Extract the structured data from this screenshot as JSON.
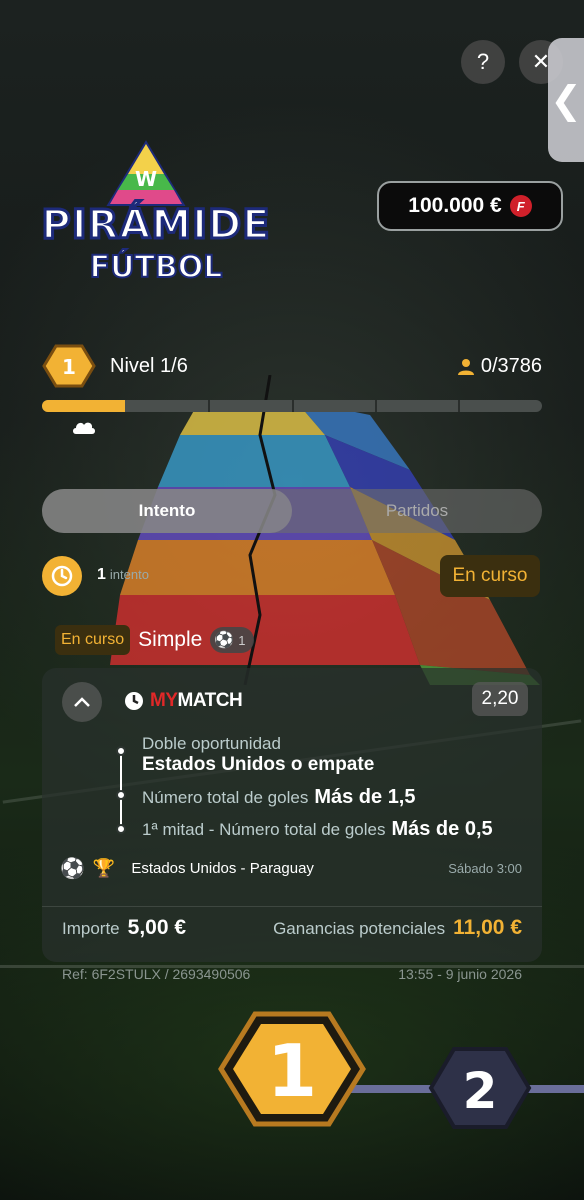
{
  "header": {
    "help_label": "?",
    "close_label": "✕",
    "side_tab_glyph": "❮",
    "logo_badge_letter": "W",
    "logo_line1": "PIRÁMIDE",
    "logo_line2": "FÚTBOL",
    "balance": "100.000 €",
    "balance_coin_letter": "F"
  },
  "level": {
    "badge_number": "1",
    "label": "Nivel 1/6",
    "players": "0/3786",
    "progress": 0.165
  },
  "tabs": [
    {
      "label": "Intento",
      "active": true
    },
    {
      "label": "Partidos",
      "active": false
    }
  ],
  "attempt": {
    "count": "1",
    "word": "intento",
    "status": "En curso"
  },
  "bet": {
    "status_pill": "En curso",
    "type": "Simple",
    "ball_count": "1",
    "brand_my": "MY",
    "brand_match": "MATCH",
    "odds": "2,20",
    "selections": [
      {
        "market": "Doble oportunidad",
        "value": "Estados Unidos o empate"
      },
      {
        "market": "Número total de goles",
        "value": "Más de 1,5"
      },
      {
        "market": "1ª mitad - Número total de goles",
        "value": "Más de 0,5"
      }
    ],
    "teams": "Estados Unidos - Paraguay",
    "date": "Sábado 3:00",
    "stake_label": "Importe",
    "stake_value": "5,00 €",
    "gain_label": "Ganancias potenciales",
    "gain_value": "11,00 €",
    "ref": "Ref: 6F2STULX / 2693490506",
    "timestamp": "13:55 - 9 junio 2026"
  },
  "level_nodes": [
    {
      "number": "1",
      "state": "current"
    },
    {
      "number": "2",
      "state": "locked"
    }
  ],
  "colors": {
    "accent": "#f2b234",
    "brand_red": "#e02828",
    "coin_red": "#d0202a",
    "node_locked": "#2e3148"
  }
}
